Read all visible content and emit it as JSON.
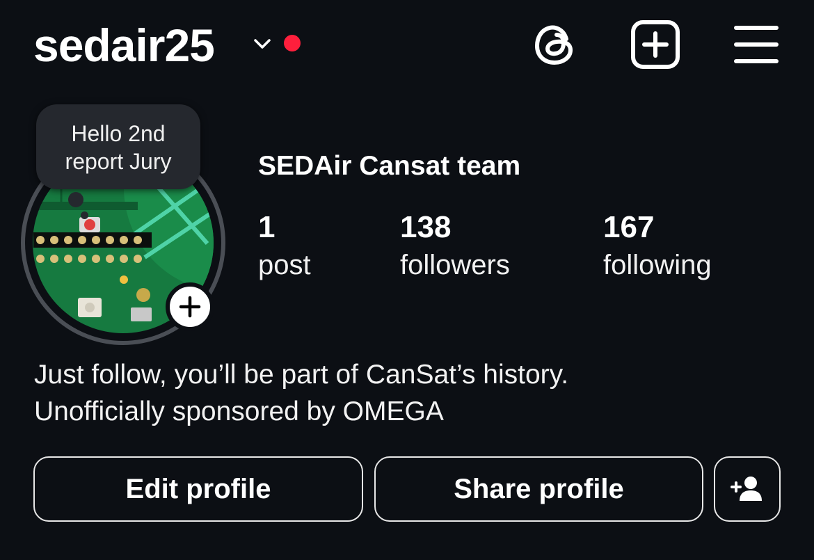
{
  "header": {
    "username": "sedair25",
    "icons": [
      "chevron-down-icon",
      "notification-dot",
      "threads-icon",
      "create-post-icon",
      "menu-icon"
    ],
    "notification_color": "#ff1f3c"
  },
  "profile": {
    "note": "Hello 2nd report Jury",
    "display_name": "SEDAir Cansat team",
    "avatar_icon": "circuit-board-photo",
    "stats": [
      {
        "count": "1",
        "label": "post"
      },
      {
        "count": "138",
        "label": "followers"
      },
      {
        "count": "167",
        "label": "following"
      }
    ],
    "bio_lines": [
      "Just follow, you’ll be part of CanSat’s history.",
      "Unofficially sponsored by OMEGA"
    ]
  },
  "actions": {
    "edit_label": "Edit profile",
    "share_label": "Share profile",
    "discover_icon": "add-person-icon"
  },
  "colors": {
    "background": "#0c0f14",
    "note_bubble": "#25282e",
    "board_green": "#1f8a4c"
  }
}
